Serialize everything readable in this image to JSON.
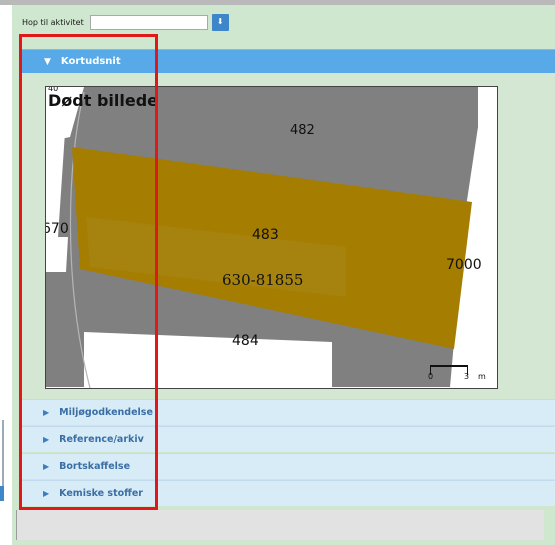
{
  "hop": {
    "label": "Hop til aktivitet",
    "value": "",
    "button_icon": "download-arrow-icon"
  },
  "kortudsnit": {
    "title": "Kortudsnit",
    "expanded": true,
    "map": {
      "overlay_text": "Dødt billede",
      "labels": {
        "top_small": "40",
        "parcel_482": "482",
        "left_670": "670",
        "parcel_483": "483",
        "right_7000": "7000",
        "matrikel": "630-81855",
        "parcel_484": "484"
      },
      "scale": {
        "zero": "0",
        "three": "3",
        "unit": "m"
      }
    }
  },
  "accordion": [
    {
      "label": "Miljøgodkendelse"
    },
    {
      "label": "Reference/arkiv"
    },
    {
      "label": "Bortskaffelse"
    },
    {
      "label": "Kemiske stoffer"
    }
  ],
  "colors": {
    "header_blue": "#57a9e7",
    "panel_green": "#cfe6cf",
    "parcel_gold": "#a57d00",
    "road_gray": "#808080",
    "highlight_red": "#e01818"
  }
}
